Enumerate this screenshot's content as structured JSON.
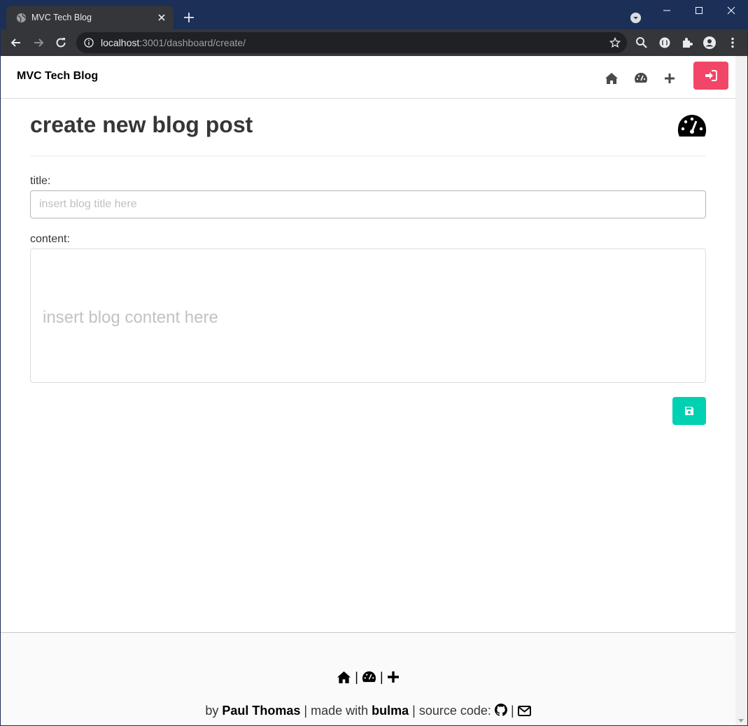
{
  "browser": {
    "tab_title": "MVC Tech Blog",
    "url_host": "localhost",
    "url_rest": ":3001/dashboard/create/"
  },
  "navbar": {
    "brand": "MVC Tech Blog"
  },
  "page": {
    "title": "create new blog post"
  },
  "form": {
    "title_label": "title:",
    "title_placeholder": "insert blog title here",
    "content_label": "content:",
    "content_placeholder": "insert blog content here"
  },
  "footer": {
    "sep": "|",
    "by": "by",
    "author": "Paul Thomas",
    "made_with": "| made with",
    "framework": "bulma",
    "source_code": "| source code:"
  },
  "colors": {
    "login_button": "#f14668",
    "save_button": "#00d1b2",
    "text": "#363636"
  },
  "icons": [
    "home-icon",
    "dashboard-icon",
    "plus-icon",
    "sign-in-icon",
    "save-icon",
    "github-icon",
    "envelope-icon"
  ]
}
